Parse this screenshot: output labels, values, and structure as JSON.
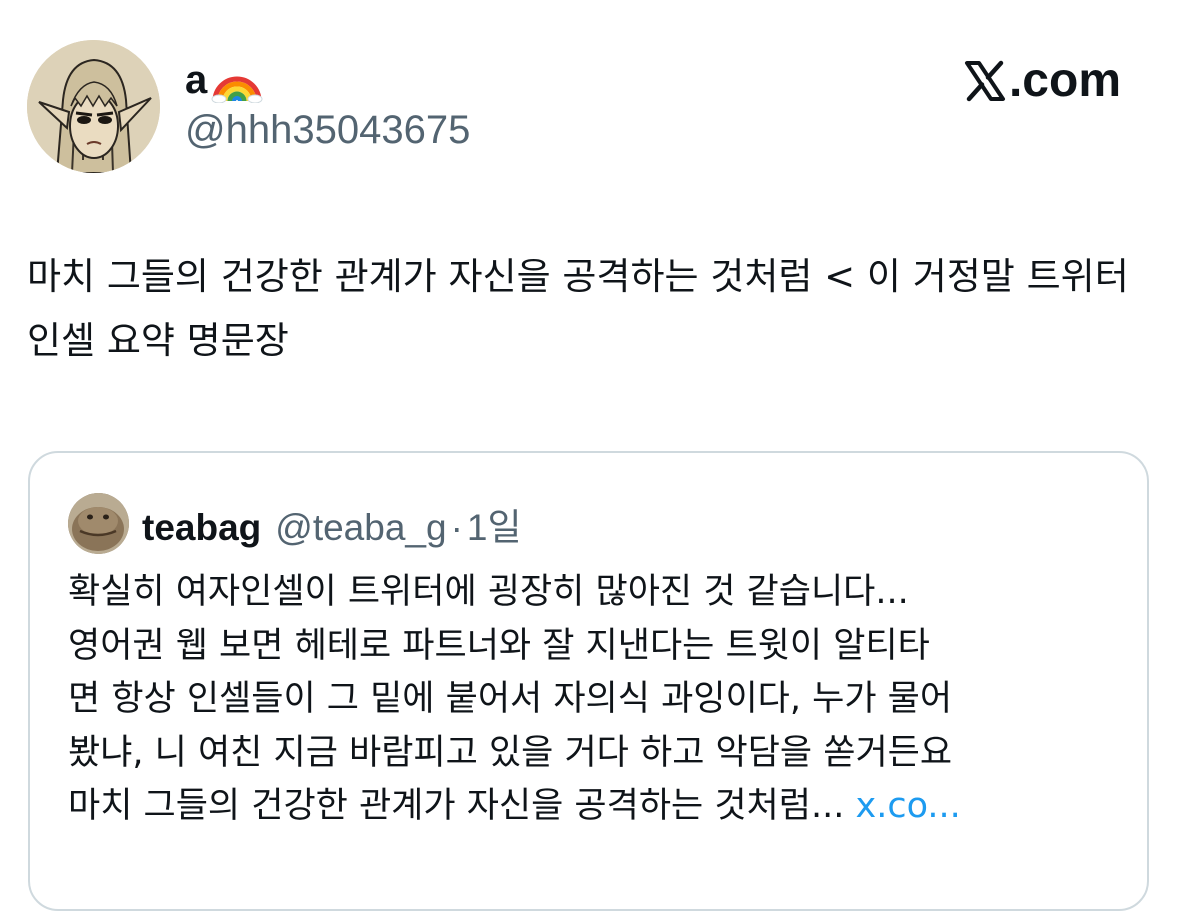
{
  "author": {
    "display_name": "a",
    "display_name_emoji": "rainbow-emoji",
    "handle": "@hhh35043675"
  },
  "brand": {
    "label": ".com",
    "logo": "x-logo-icon"
  },
  "tweet": {
    "text": "마치 그들의 건강한 관계가 자신을 공격하는 것처럼 < 이 거정말 트위터인셀 요약 명문장"
  },
  "quote": {
    "name": "teabag",
    "handle": "@teaba_g",
    "dot": "·",
    "time": "1일",
    "lines": [
      "확실히 여자인셀이 트위터에 굉장히 많아진 것 같습니다...",
      "영어권 웹 보면 헤테로 파트너와 잘 지낸다는 트윗이 알티타",
      "면 항상 인셀들이 그 밑에 붙어서 자의식 과잉이다, 누가 물어",
      "봤냐, 니 여친 지금 바람피고 있을 거다 하고 악담을 쏟거든요"
    ],
    "last_line": "마치 그들의 건강한 관계가 자신을 공격하는 것처럼...",
    "link_text": "x.co..."
  },
  "colors": {
    "text": "#0f1419",
    "muted": "#536471",
    "link": "#1d9bf0",
    "border": "#cfd9de"
  }
}
